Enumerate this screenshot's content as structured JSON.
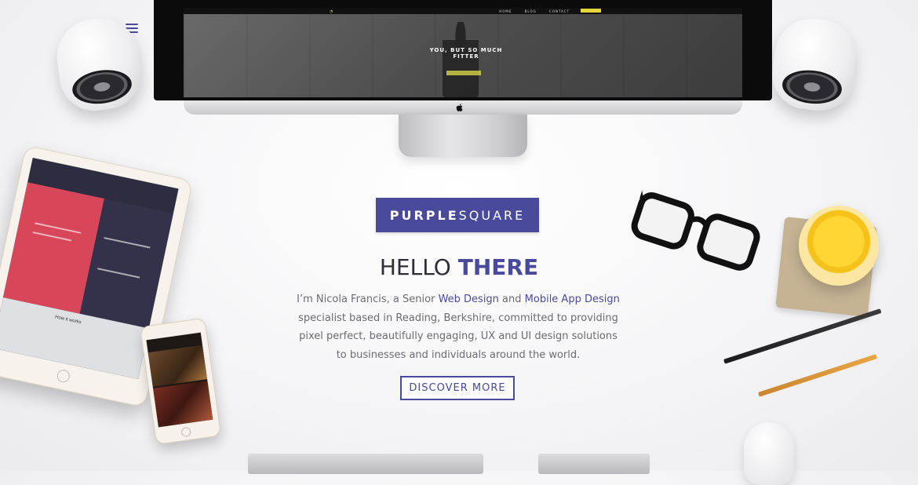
{
  "monitor": {
    "headline_line1": "YOU, BUT SO MUCH",
    "headline_line2": "FITTER",
    "nav": [
      "HOME",
      "BLOG",
      "CONTACT"
    ]
  },
  "brand": {
    "bold": "PURPLE",
    "light": "SQUARE",
    "color": "#4a4a9c"
  },
  "hero": {
    "heading_plain": "HELLO",
    "heading_accent": "THERE",
    "intro_part1": "I’m Nicola Francis, a Senior ",
    "link1": "Web Design",
    "intro_part2": " and ",
    "link2": "Mobile App Design",
    "intro_part3": " specialist based in Reading, Berkshire, committed to providing pixel perfect, beautifully engaging, UX and UI design solutions to businesses and individuals around the world.",
    "cta_label": "DISCOVER MORE"
  },
  "tablet": {
    "section_label": "How it works"
  },
  "icons": {
    "menu": "hamburger-menu-icon",
    "apple": "apple-logo-icon"
  }
}
